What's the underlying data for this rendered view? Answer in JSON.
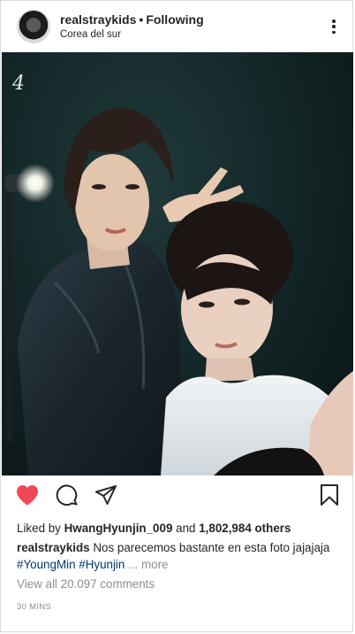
{
  "header": {
    "username": "realstraykids",
    "separator": "•",
    "follow_status": "Following",
    "location": "Corea del sur"
  },
  "photo": {
    "watermark": "4"
  },
  "icons": {
    "like": "heart-icon-filled",
    "comment": "comment-icon",
    "share": "share-icon",
    "save": "bookmark-icon",
    "options": "more-options-icon"
  },
  "colors": {
    "like_red": "#ed4956",
    "hashtag_blue": "#00376b",
    "muted_gray": "#8e8e8e",
    "text": "#262626"
  },
  "likes": {
    "prefix": "Liked by",
    "user": "HwangHyunjin_009",
    "and": "and",
    "count": "1,802,984 others"
  },
  "caption": {
    "user": "realstraykids",
    "text": "Nos parecemos bastante en esta foto jajajaja",
    "tag1": "#YoungMin",
    "tag2": "#Hyunjin",
    "ellipsis": "...",
    "more": "more"
  },
  "comments": {
    "view_all": "View all 20.097 comments"
  },
  "timestamp": "30 MINS"
}
